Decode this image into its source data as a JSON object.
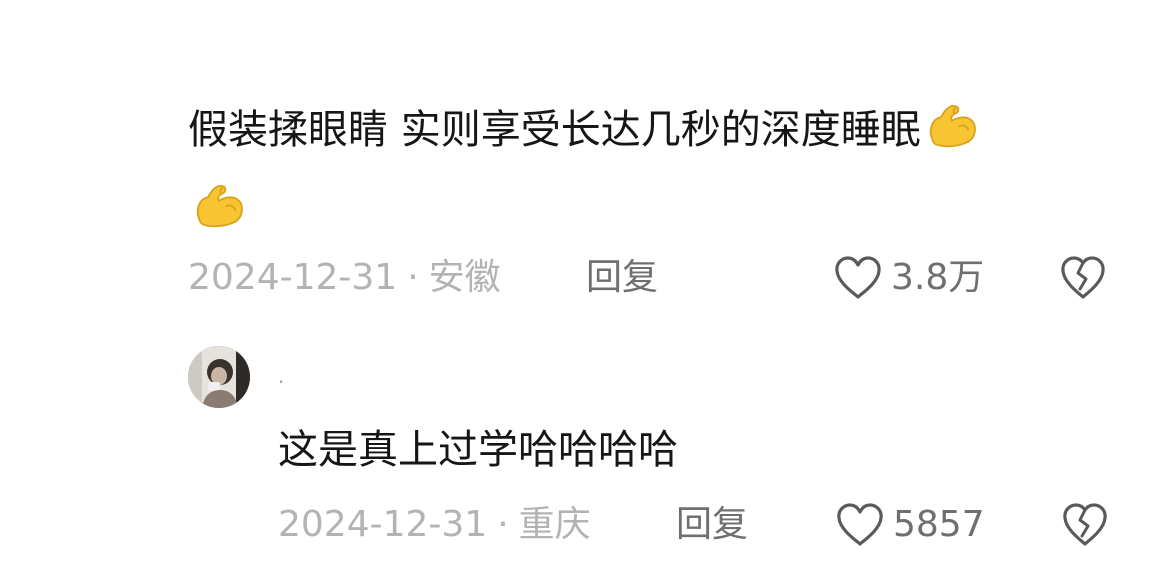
{
  "comment": {
    "text": "假装揉眼睛 实则享受长达几秒的深度睡眠",
    "emoji": "flexed-biceps",
    "date": "2024-12-31",
    "separator": "·",
    "location": "安徽",
    "reply_label": "回复",
    "like_count": "3.8万"
  },
  "reply": {
    "username": "·",
    "text": "这是真上过学哈哈哈哈",
    "date": "2024-12-31",
    "separator": "·",
    "location": "重庆",
    "reply_label": "回复",
    "like_count": "5857"
  },
  "colors": {
    "emoji_yellow": "#f7c531",
    "meta_gray": "#b3b3b3",
    "action_gray": "#6f6f6f",
    "text_dark": "#161616"
  }
}
